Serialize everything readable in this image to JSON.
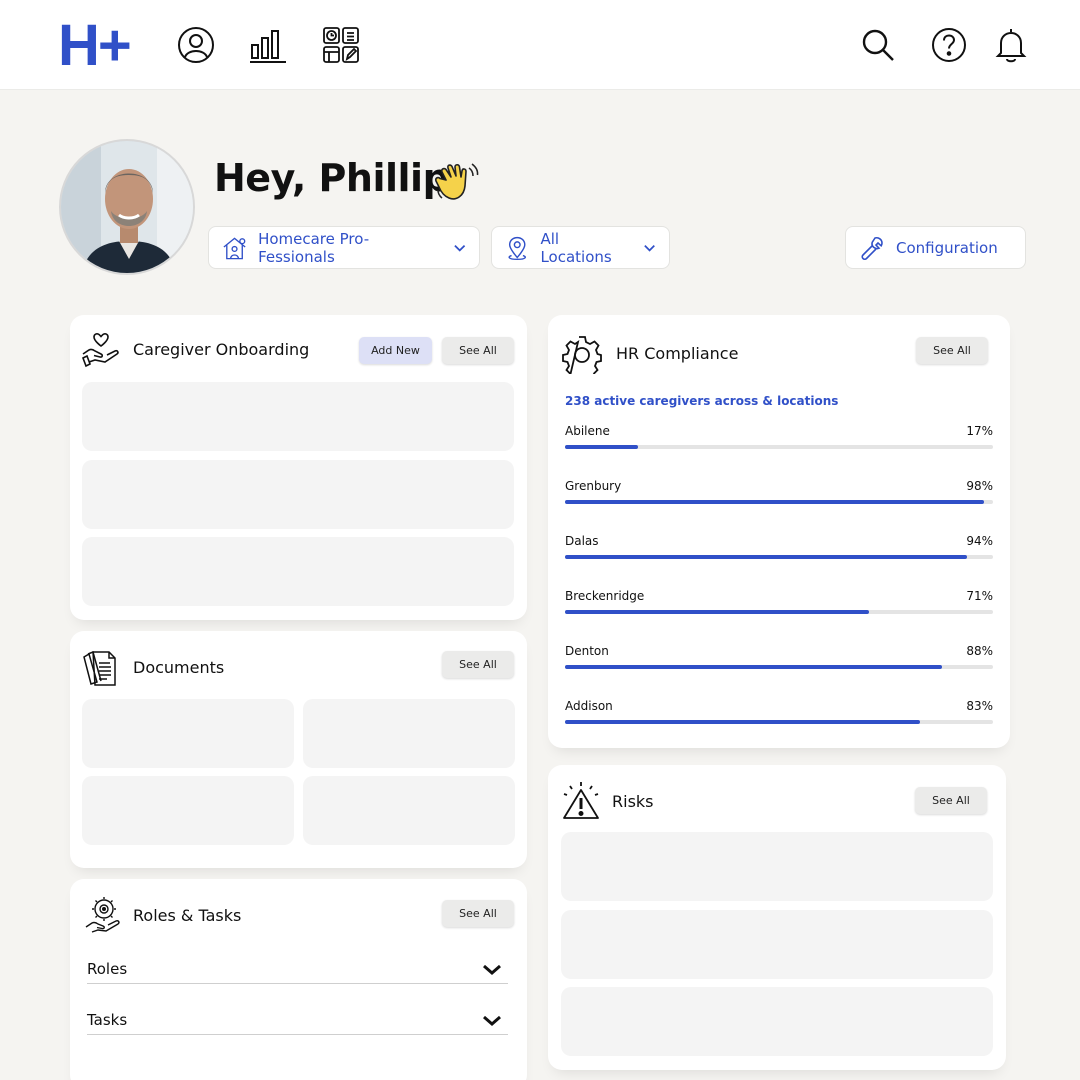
{
  "app": {
    "logo_text": "H+"
  },
  "nav": {
    "left_icons": [
      "profile-icon",
      "bar-chart-icon",
      "dashboard-grid-icon"
    ],
    "right_icons": [
      "search-icon",
      "help-icon",
      "bell-icon"
    ]
  },
  "header": {
    "greeting": "Hey, Phillip",
    "organization_select": "Homecare Pro-Fessionals",
    "location_select": "All Locations",
    "configuration_label": "Configuration"
  },
  "caregiver_onboarding": {
    "title": "Caregiver Onboarding",
    "add_label": "Add New",
    "see_all_label": "See All"
  },
  "documents": {
    "title": "Documents",
    "see_all_label": "See All"
  },
  "roles_tasks": {
    "title": "Roles & Tasks",
    "see_all_label": "See All",
    "rows": [
      {
        "label": "Roles"
      },
      {
        "label": "Tasks"
      }
    ]
  },
  "hr_compliance": {
    "title": "HR Compliance",
    "see_all_label": "See All",
    "summary": "238 active caregivers across & locations",
    "locations": [
      {
        "name": "Abilene",
        "percent_label": "17%",
        "value": 17
      },
      {
        "name": "Grenbury",
        "percent_label": "98%",
        "value": 98
      },
      {
        "name": "Dalas",
        "percent_label": "94%",
        "value": 94
      },
      {
        "name": "Breckenridge",
        "percent_label": "71%",
        "value": 71
      },
      {
        "name": "Denton",
        "percent_label": "88%",
        "value": 88
      },
      {
        "name": "Addison",
        "percent_label": "83%",
        "value": 83
      }
    ]
  },
  "risks": {
    "title": "Risks",
    "see_all_label": "See All"
  },
  "colors": {
    "brand": "#3050c8",
    "background": "#f5f4f1",
    "placeholder": "#f4f4f4"
  }
}
